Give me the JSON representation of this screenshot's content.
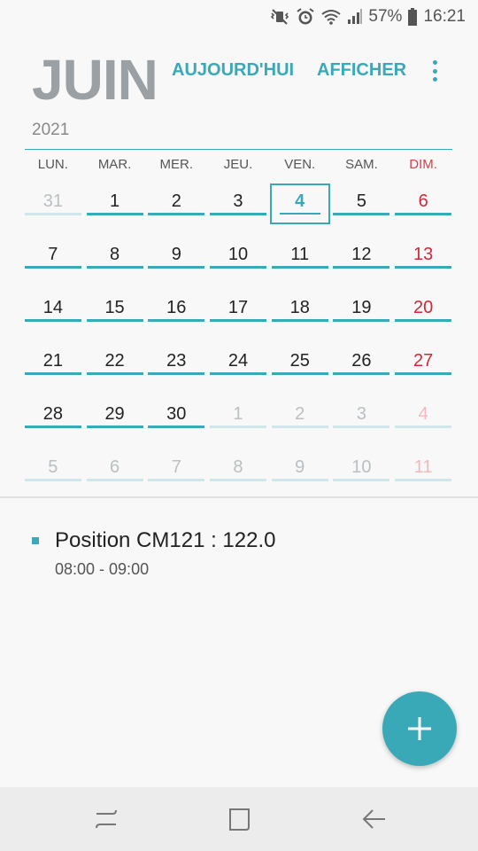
{
  "status_bar": {
    "battery_percent": "57%",
    "time": "16:21",
    "icons": [
      "mute-vibrate-icon",
      "alarm-icon",
      "wifi-icon",
      "signal-icon",
      "battery-icon"
    ]
  },
  "header": {
    "month": "JUIN",
    "today_label": "AUJOURD'HUI",
    "view_label": "AFFICHER",
    "more_icon": "more-vert-icon",
    "year": "2021"
  },
  "calendar": {
    "weekdays": [
      "LUN.",
      "MAR.",
      "MER.",
      "JEU.",
      "VEN.",
      "SAM.",
      "DIM."
    ],
    "weeks": [
      [
        {
          "d": "31",
          "m": true
        },
        {
          "d": "1"
        },
        {
          "d": "2"
        },
        {
          "d": "3"
        },
        {
          "d": "4",
          "today": true
        },
        {
          "d": "5"
        },
        {
          "d": "6"
        }
      ],
      [
        {
          "d": "7"
        },
        {
          "d": "8"
        },
        {
          "d": "9"
        },
        {
          "d": "10"
        },
        {
          "d": "11"
        },
        {
          "d": "12"
        },
        {
          "d": "13"
        }
      ],
      [
        {
          "d": "14"
        },
        {
          "d": "15"
        },
        {
          "d": "16"
        },
        {
          "d": "17"
        },
        {
          "d": "18"
        },
        {
          "d": "19"
        },
        {
          "d": "20"
        }
      ],
      [
        {
          "d": "21"
        },
        {
          "d": "22"
        },
        {
          "d": "23"
        },
        {
          "d": "24"
        },
        {
          "d": "25"
        },
        {
          "d": "26"
        },
        {
          "d": "27"
        }
      ],
      [
        {
          "d": "28"
        },
        {
          "d": "29"
        },
        {
          "d": "30"
        },
        {
          "d": "1",
          "m": true
        },
        {
          "d": "2",
          "m": true
        },
        {
          "d": "3",
          "m": true
        },
        {
          "d": "4",
          "m": true
        }
      ],
      [
        {
          "d": "5",
          "m": true
        },
        {
          "d": "6",
          "m": true
        },
        {
          "d": "7",
          "m": true
        },
        {
          "d": "8",
          "m": true
        },
        {
          "d": "9",
          "m": true
        },
        {
          "d": "10",
          "m": true
        },
        {
          "d": "11",
          "m": true
        }
      ]
    ]
  },
  "event": {
    "title": "Position CM121 : 122.0",
    "time": "08:00 - 09:00"
  },
  "colors": {
    "accent": "#3aa9b7",
    "sunday": "#d0283a"
  },
  "fab": {
    "icon": "plus-icon"
  },
  "navbar": {
    "icons": [
      "recent-apps-icon",
      "home-icon",
      "back-icon"
    ]
  }
}
